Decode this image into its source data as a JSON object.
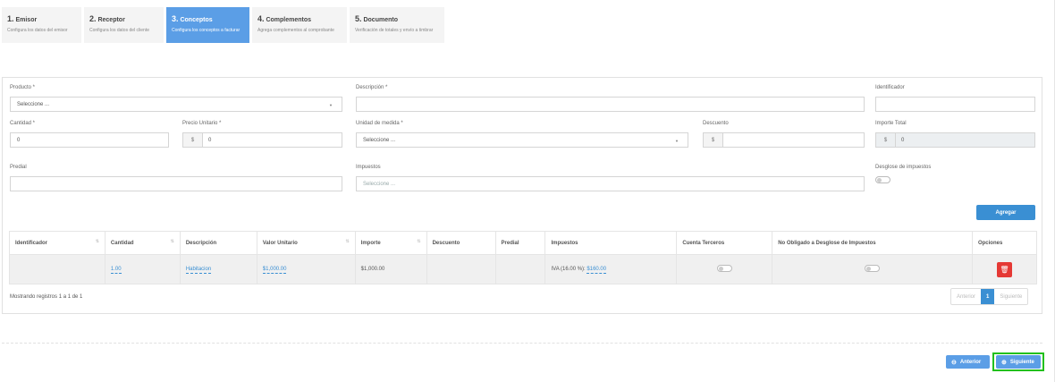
{
  "steps": [
    {
      "num": "1.",
      "title": "Emisor",
      "sub": "Configura los datos del emisor"
    },
    {
      "num": "2.",
      "title": "Receptor",
      "sub": "Configura los datos del cliente"
    },
    {
      "num": "3.",
      "title": "Conceptos",
      "sub": "Configura los conceptos a facturar"
    },
    {
      "num": "4.",
      "title": "Complementos",
      "sub": "Agrega complementos al comprobante"
    },
    {
      "num": "5.",
      "title": "Documento",
      "sub": "Verificación de totales y envío a timbrar"
    }
  ],
  "form": {
    "producto_label": "Producto *",
    "producto_value": "Seleccione ...",
    "descripcion_label": "Descripción *",
    "descripcion_value": "",
    "identificador_label": "Identificador",
    "identificador_value": "",
    "cantidad_label": "Cantidad *",
    "cantidad_value": "0",
    "precio_label": "Precio Unitario *",
    "precio_prefix": "$",
    "precio_value": "0",
    "unidad_label": "Unidad de medida *",
    "unidad_value": "Seleccione ...",
    "descuento_label": "Descuento",
    "descuento_prefix": "$",
    "descuento_value": "",
    "importe_label": "Importe Total",
    "importe_prefix": "$",
    "importe_value": "0",
    "predial_label": "Predial",
    "predial_value": "",
    "impuestos_label": "Impuestos",
    "impuestos_placeholder": "Seleccione ...",
    "desglose_label": "Desglose de impuestos",
    "agregar_label": "Agregar"
  },
  "table": {
    "headers": [
      "Identificador",
      "Cantidad",
      "Descripción",
      "Valor Unitario",
      "Importe",
      "Descuento",
      "Predial",
      "Impuestos",
      "Cuenta Terceros",
      "No Obligado a Desglose de Impuestos",
      "Opciones"
    ],
    "row": {
      "identificador": "",
      "cantidad": "1.00",
      "descripcion": "Habitacion",
      "valor_unitario": "$1,000.00",
      "importe": "$1,000.00",
      "descuento": "",
      "predial": "",
      "impuestos_prefix": "IVA (16.00 %):",
      "impuestos_value": "$160.00"
    },
    "info": "Mostrando registros 1 a 1 de 1",
    "pager": {
      "prev": "Anterior",
      "current": "1",
      "next": "Siguiente"
    }
  },
  "nav": {
    "anterior": "Anterior",
    "siguiente": "Siguiente"
  },
  "colors": {
    "accent": "#3a8fd3",
    "active_step": "#5b9ee6",
    "delete": "#e53935",
    "highlight": "#22c01d"
  }
}
